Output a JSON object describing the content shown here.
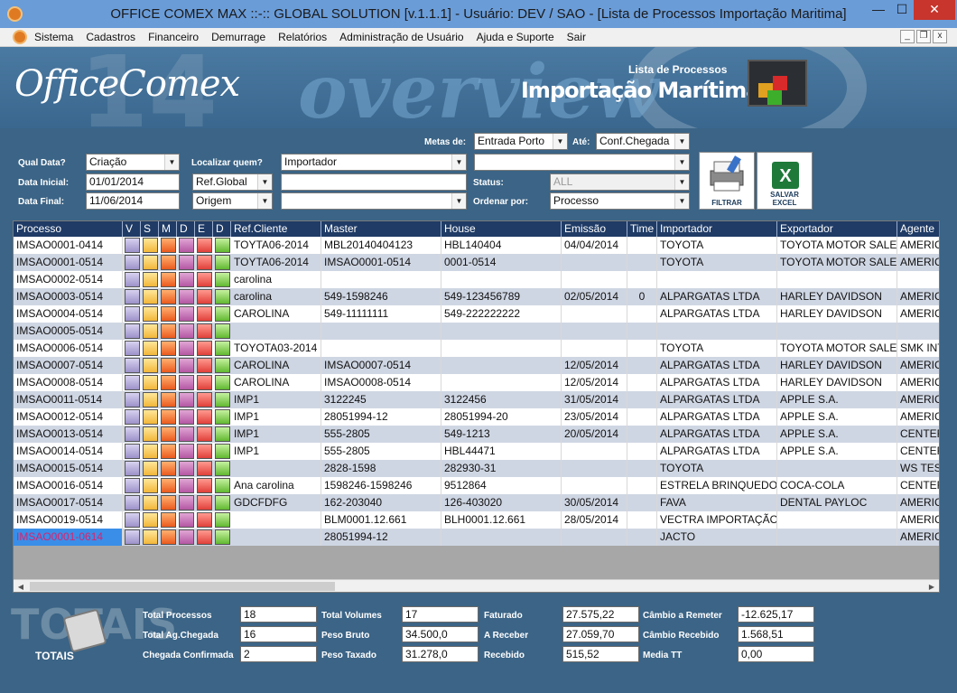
{
  "window": {
    "title": "OFFICE COMEX MAX ::-:: GLOBAL SOLUTION [v.1.1.1] - Usuário: DEV / SAO - [Lista de Processos Importação Maritima]",
    "minimize": "—",
    "maximize": "☐",
    "close": "✕"
  },
  "menu": {
    "items": [
      "Sistema",
      "Cadastros",
      "Financeiro",
      "Demurrage",
      "Relatórios",
      "Administração de Usuário",
      "Ajuda e Suporte",
      "Sair"
    ],
    "mdi_min": "_",
    "mdi_restore": "❐",
    "mdi_close": "x"
  },
  "banner": {
    "logo": "OfficeComex",
    "number": "14",
    "overview": "overview",
    "subtitle": "Lista de Processos",
    "title": "Importação Marítima"
  },
  "filters": {
    "metas_label": "Metas de:",
    "metas_value": "Entrada Porto",
    "ate_label": "Até:",
    "ate_value": "Conf.Chegada",
    "qual_data_label": "Qual Data?",
    "qual_data_value": "Criação",
    "data_inicial_label": "Data Inicial:",
    "data_inicial_value": "01/01/2014",
    "data_final_label": "Data Final:",
    "data_final_value": "11/06/2014",
    "localizar_label": "Localizar quem?",
    "localizar_value1": "Ref.Global",
    "localizar_value2": "Origem",
    "importador_value": "Importador",
    "search_value": "",
    "origem_value": "",
    "extra_value": "",
    "status_label": "Status:",
    "status_value": "ALL",
    "ordenar_label": "Ordenar por:",
    "ordenar_value": "Processo",
    "filtrar_label": "FILTRAR",
    "salvar_label": "SALVAR EXCEL"
  },
  "grid": {
    "columns": [
      "Processo",
      "V",
      "S",
      "M",
      "D",
      "E",
      "D",
      "Ref.Cliente",
      "Master",
      "House",
      "Emissão",
      "Time",
      "Importador",
      "Exportador",
      "Agente"
    ],
    "rows": [
      {
        "processo": "IMSAO0001-0414",
        "ref": "TOYTA06-2014",
        "master": "MBL20140404123",
        "house": "HBL140404",
        "emissao": "04/04/2014",
        "time": "",
        "importador": "TOYOTA",
        "exportador": "TOYOTA MOTOR SALES",
        "agente": "AMERIC"
      },
      {
        "processo": "IMSAO0001-0514",
        "ref": "TOYTA06-2014",
        "master": "IMSAO0001-0514",
        "house": "0001-0514",
        "emissao": "",
        "time": "",
        "importador": "TOYOTA",
        "exportador": "TOYOTA MOTOR SALES",
        "agente": "AMERIC"
      },
      {
        "processo": "IMSAO0002-0514",
        "ref": "carolina",
        "master": "",
        "house": "",
        "emissao": "",
        "time": "",
        "importador": "",
        "exportador": "",
        "agente": ""
      },
      {
        "processo": "IMSAO0003-0514",
        "ref": "carolina",
        "master": "549-1598246",
        "house": "549-123456789",
        "emissao": "02/05/2014",
        "time": "0",
        "importador": "ALPARGATAS LTDA",
        "exportador": "HARLEY DAVIDSON",
        "agente": "AMERIC"
      },
      {
        "processo": "IMSAO0004-0514",
        "ref": "CAROLINA",
        "master": "549-11111111",
        "house": "549-222222222",
        "emissao": "",
        "time": "",
        "importador": "ALPARGATAS LTDA",
        "exportador": "HARLEY DAVIDSON",
        "agente": "AMERIC"
      },
      {
        "processo": "IMSAO0005-0514",
        "ref": "",
        "master": "",
        "house": "",
        "emissao": "",
        "time": "",
        "importador": "",
        "exportador": "",
        "agente": ""
      },
      {
        "processo": "IMSAO0006-0514",
        "ref": "TOYOTA03-2014",
        "master": "",
        "house": "",
        "emissao": "",
        "time": "",
        "importador": "TOYOTA",
        "exportador": "TOYOTA MOTOR SALES",
        "agente": "SMK INT"
      },
      {
        "processo": "IMSAO0007-0514",
        "ref": "CAROLINA",
        "master": "IMSAO0007-0514",
        "house": "",
        "emissao": "12/05/2014",
        "time": "",
        "importador": "ALPARGATAS LTDA",
        "exportador": "HARLEY DAVIDSON",
        "agente": "AMERIC"
      },
      {
        "processo": "IMSAO0008-0514",
        "ref": "CAROLINA",
        "master": "IMSAO0008-0514",
        "house": "",
        "emissao": "12/05/2014",
        "time": "",
        "importador": "ALPARGATAS LTDA",
        "exportador": "HARLEY DAVIDSON",
        "agente": "AMERIC"
      },
      {
        "processo": "IMSAO0011-0514",
        "ref": "IMP1",
        "master": "3122245",
        "house": "3122456",
        "emissao": "31/05/2014",
        "time": "",
        "importador": "ALPARGATAS LTDA",
        "exportador": "APPLE S.A.",
        "agente": "AMERIC"
      },
      {
        "processo": "IMSAO0012-0514",
        "ref": "IMP1",
        "master": "28051994-12",
        "house": "28051994-20",
        "emissao": "23/05/2014",
        "time": "",
        "importador": "ALPARGATAS LTDA",
        "exportador": "APPLE S.A.",
        "agente": "AMERIC"
      },
      {
        "processo": "IMSAO0013-0514",
        "ref": "IMP1",
        "master": "555-2805",
        "house": "549-1213",
        "emissao": "20/05/2014",
        "time": "",
        "importador": "ALPARGATAS LTDA",
        "exportador": "APPLE S.A.",
        "agente": "CENTER"
      },
      {
        "processo": "IMSAO0014-0514",
        "ref": "IMP1",
        "master": "555-2805",
        "house": "HBL44471",
        "emissao": "",
        "time": "",
        "importador": "ALPARGATAS LTDA",
        "exportador": "APPLE S.A.",
        "agente": "CENTER"
      },
      {
        "processo": "IMSAO0015-0514",
        "ref": "",
        "master": "2828-1598",
        "house": "282930-31",
        "emissao": "",
        "time": "",
        "importador": "TOYOTA",
        "exportador": "",
        "agente": "WS TES"
      },
      {
        "processo": "IMSAO0016-0514",
        "ref": "Ana carolina",
        "master": "1598246-1598246",
        "house": "9512864",
        "emissao": "",
        "time": "",
        "importador": "ESTRELA BRINQUEDO",
        "exportador": "COCA-COLA",
        "agente": "CENTER"
      },
      {
        "processo": "IMSAO0017-0514",
        "ref": "GDCFDFG",
        "master": "162-203040",
        "house": "126-403020",
        "emissao": "30/05/2014",
        "time": "",
        "importador": "FAVA",
        "exportador": "DENTAL PAYLOC",
        "agente": "AMERIC"
      },
      {
        "processo": "IMSAO0019-0514",
        "ref": "",
        "master": "BLM0001.12.661",
        "house": "BLH0001.12.661",
        "emissao": "28/05/2014",
        "time": "",
        "importador": "VECTRA IMPORTAÇÃO",
        "exportador": "",
        "agente": "AMERIC"
      },
      {
        "processo": "IMSAO0001-0614",
        "ref": "",
        "master": "28051994-12",
        "house": "",
        "emissao": "",
        "time": "",
        "importador": "JACTO",
        "exportador": "",
        "agente": "AMERIC"
      }
    ]
  },
  "totals": {
    "watermark": "TOTAIS",
    "label": "TOTAIS",
    "total_processos_label": "Total Processos",
    "total_processos": "18",
    "total_ag_chegada_label": "Total Ag.Chegada",
    "total_ag_chegada": "16",
    "chegada_confirmada_label": "Chegada Confirmada",
    "chegada_confirmada": "2",
    "total_volumes_label": "Total Volumes",
    "total_volumes": "17",
    "peso_bruto_label": "Peso Bruto",
    "peso_bruto": "34.500,0",
    "peso_taxado_label": "Peso Taxado",
    "peso_taxado": "31.278,0",
    "faturado_label": "Faturado",
    "faturado": "27.575,22",
    "a_receber_label": "A Receber",
    "a_receber": "27.059,70",
    "recebido_label": "Recebido",
    "recebido": "515,52",
    "cambio_remeter_label": "Câmbio a Remeter",
    "cambio_remeter": "-12.625,17",
    "cambio_recebido_label": "Câmbio Recebido",
    "cambio_recebido": "1.568,51",
    "media_tt_label": "Media TT",
    "media_tt": "0,00"
  }
}
